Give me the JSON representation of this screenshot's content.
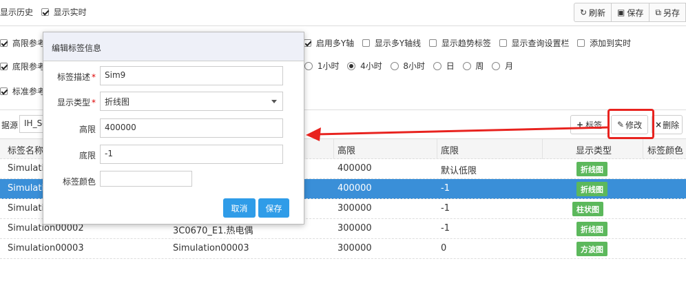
{
  "topbar": {
    "show_history": "显示历史",
    "show_realtime": "显示实时",
    "refresh": "刷新",
    "save": "保存",
    "save_as": "另存"
  },
  "options": {
    "row1": [
      "高限参考线",
      "启用多Y轴",
      "显示多Y轴线",
      "显示趋势标签",
      "显示查询设置栏",
      "添加到实时"
    ],
    "row2": [
      "底限参考线",
      "1小时",
      "4小时",
      "8小时",
      "日",
      "周",
      "月"
    ],
    "row3": [
      "标准参考线"
    ]
  },
  "source": {
    "label": "据源",
    "value": "IH_Se",
    "add_tag": "标签",
    "edit": "修改",
    "delete": "删除"
  },
  "table": {
    "headers": [
      "标签名称",
      "高限",
      "底限",
      "显示类型",
      "标签颜色"
    ],
    "rows": [
      {
        "name": "Simulation",
        "desc": "",
        "high": "400000",
        "low": "默认低限",
        "type": "折线图"
      },
      {
        "name": "Simulation",
        "desc": "",
        "high": "400000",
        "low": "-1",
        "type": "折线图"
      },
      {
        "name": "Simulation",
        "desc": "",
        "high": "300000",
        "low": "-1",
        "type": "柱状图"
      },
      {
        "name": "Simulation00002",
        "desc": "3C0670_E1.热电偶",
        "high": "300000",
        "low": "-1",
        "type": "折线图"
      },
      {
        "name": "Simulation00003",
        "desc": "Simulation00003",
        "high": "300000",
        "low": "0",
        "type": "方波图"
      }
    ]
  },
  "modal": {
    "title": "编辑标签信息",
    "desc_label": "标签描述",
    "desc_value": "Sim9",
    "type_label": "显示类型",
    "type_value": "折线图",
    "high_label": "高限",
    "high_value": "400000",
    "low_label": "底限",
    "low_value": "-1",
    "color_label": "标签颜色",
    "cancel": "取消",
    "save": "保存"
  },
  "colors": {
    "accent": "#2f9ce8",
    "selected_row": "#3a8fd8",
    "badge": "#5cb85c",
    "highlight": "#e8231f"
  }
}
